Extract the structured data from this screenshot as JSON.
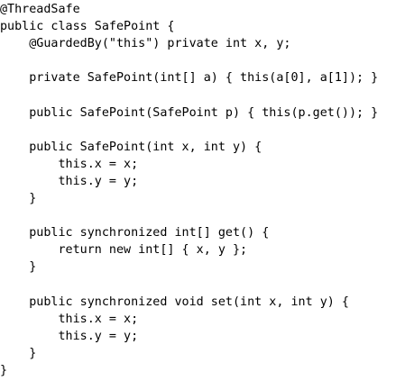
{
  "code_listing": {
    "lines": [
      "@ThreadSafe",
      "public class SafePoint {",
      "    @GuardedBy(\"this\") private int x, y;",
      "",
      "    private SafePoint(int[] a) { this(a[0], a[1]); }",
      "",
      "    public SafePoint(SafePoint p) { this(p.get()); }",
      "",
      "    public SafePoint(int x, int y) {",
      "        this.x = x;",
      "        this.y = y;",
      "    }",
      "",
      "    public synchronized int[] get() {",
      "        return new int[] { x, y };",
      "    }",
      "",
      "    public synchronized void set(int x, int y) {",
      "        this.x = x;",
      "        this.y = y;",
      "    }",
      "}"
    ]
  }
}
